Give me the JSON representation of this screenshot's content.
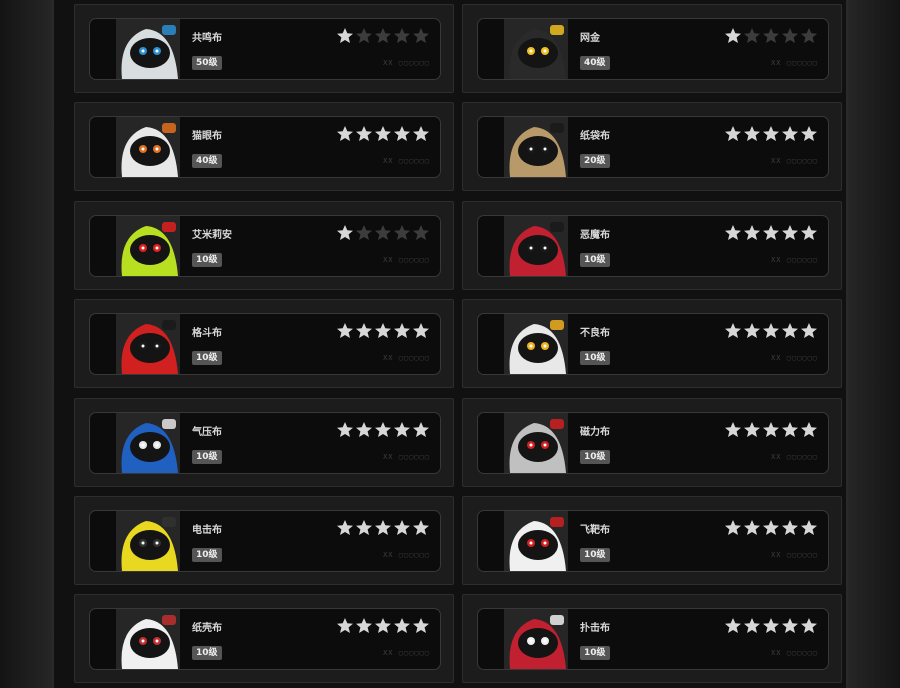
{
  "cards": [
    {
      "name": "共鸣布",
      "level": "50级",
      "stars": 1,
      "code": "XX ▢▢▢▢▢▢",
      "colors": {
        "body": "#d8dde0",
        "accent": "#2a8fd0"
      }
    },
    {
      "name": "网金",
      "level": "40级",
      "stars": 1,
      "code": "XX ▢▢▢▢▢▢",
      "colors": {
        "body": "#2a2a2a",
        "accent": "#f0c020"
      }
    },
    {
      "name": "猫眼布",
      "level": "40级",
      "stars": 5,
      "code": "XX ▢▢▢▢▢▢",
      "colors": {
        "body": "#e8e8e8",
        "accent": "#e07020"
      }
    },
    {
      "name": "纸袋布",
      "level": "20级",
      "stars": 5,
      "code": "XX ▢▢▢▢▢▢",
      "colors": {
        "body": "#b89a6a",
        "accent": "#1a1a1a"
      }
    },
    {
      "name": "艾米莉安",
      "level": "10级",
      "stars": 1,
      "code": "XX ▢▢▢▢▢▢",
      "colors": {
        "body": "#b8e020",
        "accent": "#e02020"
      }
    },
    {
      "name": "恶魔布",
      "level": "10级",
      "stars": 5,
      "code": "XX ▢▢▢▢▢▢",
      "colors": {
        "body": "#c02030",
        "accent": "#1a1a1a"
      }
    },
    {
      "name": "格斗布",
      "level": "10级",
      "stars": 5,
      "code": "XX ▢▢▢▢▢▢",
      "colors": {
        "body": "#d02020",
        "accent": "#1a1a1a"
      }
    },
    {
      "name": "不良布",
      "level": "10级",
      "stars": 5,
      "code": "XX ▢▢▢▢▢▢",
      "colors": {
        "body": "#e8e8e8",
        "accent": "#f0b020"
      }
    },
    {
      "name": "气压布",
      "level": "10级",
      "stars": 5,
      "code": "XX ▢▢▢▢▢▢",
      "colors": {
        "body": "#2060c0",
        "accent": "#e8e8e8"
      }
    },
    {
      "name": "磁力布",
      "level": "10级",
      "stars": 5,
      "code": "XX ▢▢▢▢▢▢",
      "colors": {
        "body": "#c0c0c0",
        "accent": "#d02020"
      }
    },
    {
      "name": "电击布",
      "level": "10级",
      "stars": 5,
      "code": "XX ▢▢▢▢▢▢",
      "colors": {
        "body": "#e8d820",
        "accent": "#333333"
      }
    },
    {
      "name": "飞靶布",
      "level": "10级",
      "stars": 5,
      "code": "XX ▢▢▢▢▢▢",
      "colors": {
        "body": "#f0f0f0",
        "accent": "#d02020"
      }
    },
    {
      "name": "纸壳布",
      "level": "10级",
      "stars": 5,
      "code": "XX ▢▢▢▢▢▢",
      "colors": {
        "body": "#f0f0f0",
        "accent": "#c03030"
      }
    },
    {
      "name": "扑击布",
      "level": "10级",
      "stars": 5,
      "code": "XX ▢▢▢▢▢▢",
      "colors": {
        "body": "#c02030",
        "accent": "#f0f0f0"
      }
    }
  ],
  "max_stars": 5
}
